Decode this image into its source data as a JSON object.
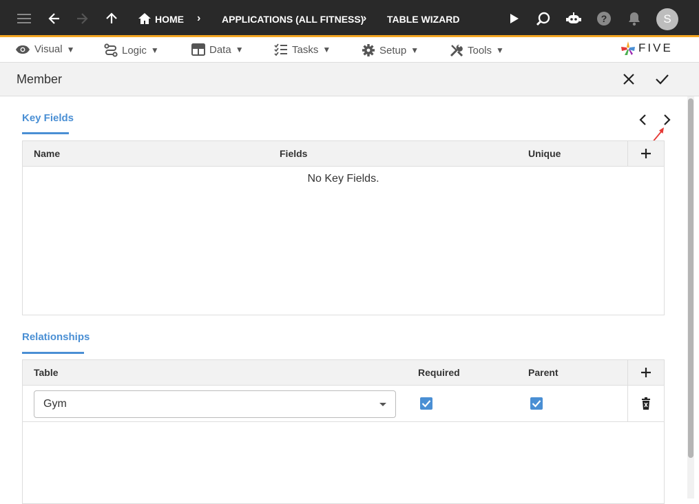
{
  "topbar": {
    "breadcrumbs": [
      "HOME",
      "APPLICATIONS (ALL FITNESS)",
      "TABLE WIZARD"
    ],
    "avatar_letter": "S"
  },
  "menubar": {
    "items": [
      {
        "label": "Visual",
        "icon": "eye-icon"
      },
      {
        "label": "Logic",
        "icon": "logic-icon"
      },
      {
        "label": "Data",
        "icon": "table-icon"
      },
      {
        "label": "Tasks",
        "icon": "tasks-icon"
      },
      {
        "label": "Setup",
        "icon": "gear-icon"
      },
      {
        "label": "Tools",
        "icon": "tools-icon"
      }
    ],
    "caret": "▼",
    "logo_text": "FIVE"
  },
  "header": {
    "title": "Member"
  },
  "key_fields": {
    "section_title": "Key Fields",
    "columns": [
      "Name",
      "Fields",
      "Unique"
    ],
    "empty_text": "No Key Fields."
  },
  "relationships": {
    "section_title": "Relationships",
    "columns": [
      "Table",
      "Required",
      "Parent"
    ],
    "rows": [
      {
        "table": "Gym",
        "required": true,
        "parent": true
      }
    ]
  },
  "colors": {
    "accent": "#4a8fd4",
    "topbar": "#292929",
    "topbar_border": "#f5a623",
    "annotation_arrow": "#e53935"
  }
}
